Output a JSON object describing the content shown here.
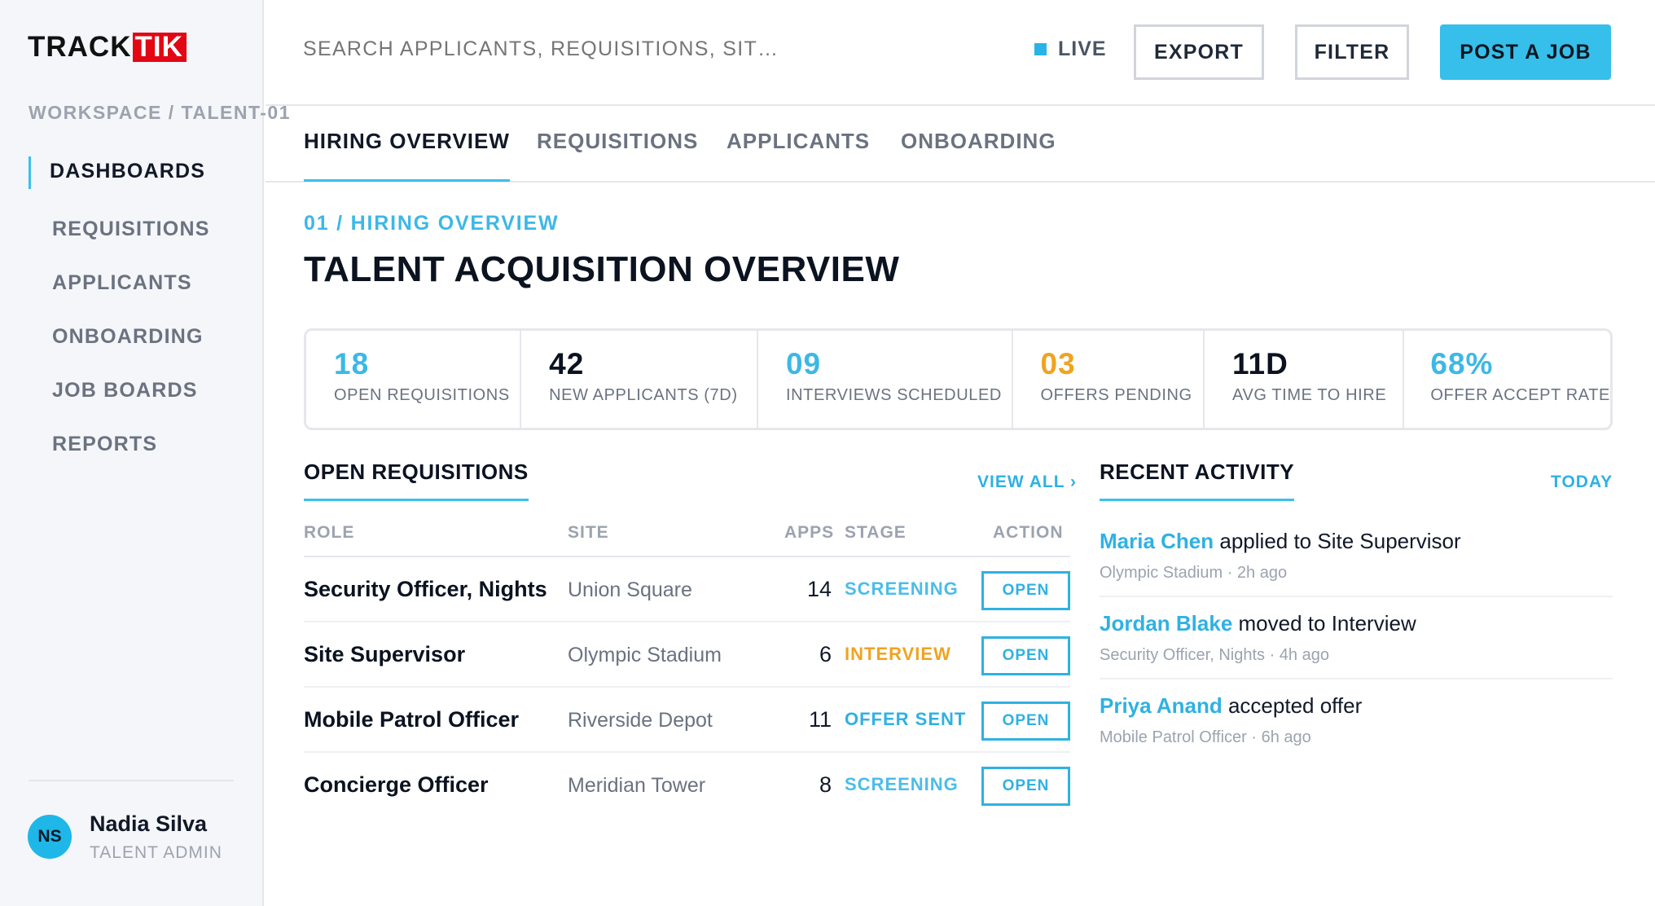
{
  "brand": {
    "part1": "TRACK",
    "part2": "TIK",
    "accent": "#e30613"
  },
  "sidebar": {
    "breadcrumb": "WORKSPACE / TALENT-01",
    "items": [
      {
        "label": "DASHBOARDS",
        "active": true
      },
      {
        "label": "REQUISITIONS"
      },
      {
        "label": "APPLICANTS"
      },
      {
        "label": "ONBOARDING"
      },
      {
        "label": "JOB BOARDS"
      },
      {
        "label": "REPORTS"
      }
    ],
    "user": {
      "initials": "NS",
      "name": "Nadia Silva",
      "role": "TALENT ADMIN"
    }
  },
  "topbar": {
    "search_placeholder": "SEARCH APPLICANTS, REQUISITIONS, SIT…",
    "live_label": "LIVE",
    "export_label": "EXPORT",
    "filter_label": "FILTER",
    "post_label": "POST A JOB",
    "accent": "#35bfea"
  },
  "tabs": [
    {
      "label": "HIRING OVERVIEW",
      "active": true
    },
    {
      "label": "REQUISITIONS"
    },
    {
      "label": "APPLICANTS"
    },
    {
      "label": "ONBOARDING"
    }
  ],
  "main": {
    "kicker": "01 / HIRING OVERVIEW",
    "title": "TALENT ACQUISITION OVERVIEW"
  },
  "kpis": [
    {
      "value": "18",
      "label": "OPEN REQUISITIONS",
      "color": "#3cb8e6"
    },
    {
      "value": "42",
      "label": "NEW APPLICANTS (7D)",
      "color": "#0b1220"
    },
    {
      "value": "09",
      "label": "INTERVIEWS SCHEDULED",
      "color": "#3cb8e6"
    },
    {
      "value": "03",
      "label": "OFFERS PENDING",
      "color": "#f0a320"
    },
    {
      "value": "11D",
      "label": "AVG TIME TO HIRE",
      "color": "#0b1220"
    },
    {
      "value": "68%",
      "label": "OFFER ACCEPT RATE",
      "color": "#3cb8e6"
    }
  ],
  "requisitions": {
    "title": "OPEN REQUISITIONS",
    "view_all": "VIEW ALL ›",
    "columns": {
      "role": "ROLE",
      "site": "SITE",
      "apps": "APPS",
      "stage": "STAGE",
      "action": "ACTION"
    },
    "rows": [
      {
        "role": "Security Officer, Nights",
        "site": "Union Square",
        "apps": "14",
        "stage": "SCREENING",
        "stage_color": "#4bbde9",
        "action": "OPEN"
      },
      {
        "role": "Site Supervisor",
        "site": "Olympic Stadium",
        "apps": "6",
        "stage": "INTERVIEW",
        "stage_color": "#f0a320",
        "action": "OPEN"
      },
      {
        "role": "Mobile Patrol Officer",
        "site": "Riverside Depot",
        "apps": "11",
        "stage": "OFFER SENT",
        "stage_color": "#2fb1e3",
        "action": "OPEN"
      },
      {
        "role": "Concierge Officer",
        "site": "Meridian Tower",
        "apps": "8",
        "stage": "SCREENING",
        "stage_color": "#4bbde9",
        "action": "OPEN"
      }
    ]
  },
  "activity": {
    "title": "RECENT ACTIVITY",
    "period": "TODAY",
    "items": [
      {
        "name": "Maria Chen",
        "text": " applied to Site Supervisor",
        "meta": "Olympic Stadium · 2h ago"
      },
      {
        "name": "Jordan Blake",
        "text": " moved to Interview",
        "meta": "Security Officer, Nights · 4h ago"
      },
      {
        "name": "Priya Anand",
        "text": " accepted offer",
        "meta": "Mobile Patrol Officer · 6h ago"
      }
    ]
  }
}
